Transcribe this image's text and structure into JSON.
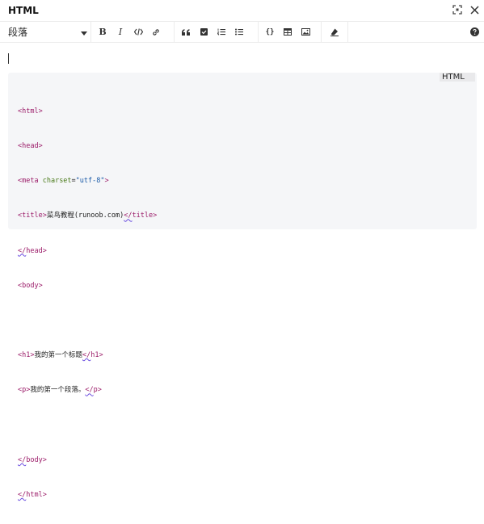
{
  "window": {
    "title": "HTML",
    "fullscreen_icon": "fullscreen-icon",
    "close_icon": "close-icon"
  },
  "toolbar": {
    "format_select": {
      "value": "段落"
    },
    "buttons": [
      "bold-icon",
      "italic-icon",
      "code-icon",
      "link-icon",
      "blockquote-icon",
      "checklist-icon",
      "ordered-list-icon",
      "bullet-list-icon",
      "code-block-icon",
      "table-icon",
      "image-icon",
      "clear-format-icon",
      "help-icon"
    ]
  },
  "editor": {
    "code_block": {
      "language": "HTML",
      "lines": {
        "l1": {
          "a": "<html>"
        },
        "l2": {
          "a": "<head>"
        },
        "l3": {
          "a": "<meta ",
          "b": "charset",
          "c": "=",
          "d": "\"utf-8\"",
          "e": ">"
        },
        "l4": {
          "a": "<title>",
          "b": "菜鸟教程(runoob.com)",
          "c": "</",
          "d": "title>"
        },
        "l5": {
          "a": "</",
          "b": "head>"
        },
        "l6": {
          "a": "<body>"
        },
        "l7": {
          "a": ""
        },
        "l8": {
          "a": "<h1>",
          "b": "我的第一个标题",
          "c": "</",
          "d": "h1>"
        },
        "l9": {
          "a": "<p>",
          "b": "我的第一个段落。",
          "c": "</",
          "d": "p>"
        },
        "l10": {
          "a": ""
        },
        "l11": {
          "a": "</",
          "b": "body>"
        },
        "l12": {
          "a": "</",
          "b": "html>"
        }
      }
    }
  }
}
